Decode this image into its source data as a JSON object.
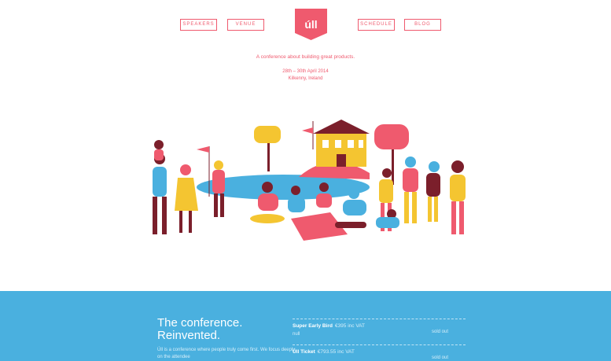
{
  "nav": {
    "speakers": "SPEAKERS",
    "venue": "VENUE",
    "logo": "úll",
    "schedule": "SCHEDULE",
    "blog": "BLOG"
  },
  "hero": {
    "tagline": "A conference about building great products.",
    "dates": "28th – 30th April 2014",
    "location": "Kilkenny, Ireland"
  },
  "footer": {
    "title_line1": "The conference.",
    "title_line2": "Reinvented.",
    "description": "Úll is a conference where people truly come first. We focus deeply on the attendee"
  },
  "tickets": [
    {
      "name": "Super Early Bird",
      "price": "€395 inc VAT",
      "sub": "null",
      "status": "sold out"
    },
    {
      "name": "Úll Ticket",
      "price": "€793.55 inc VAT",
      "sub": "",
      "status": "sold out"
    }
  ],
  "colors": {
    "accent": "#ef5a6e",
    "footer_bg": "#4ab0df"
  }
}
